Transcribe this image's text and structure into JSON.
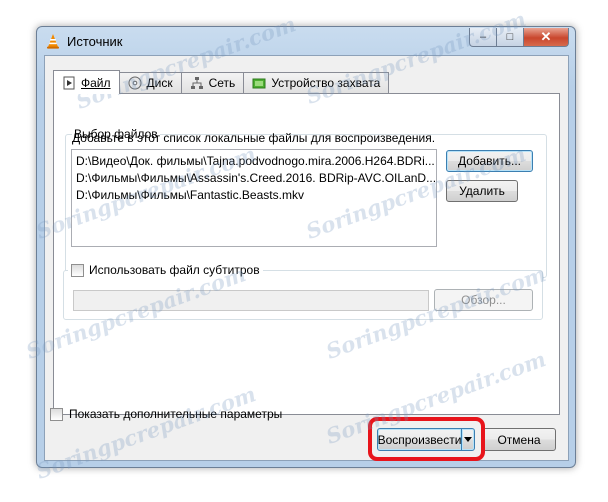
{
  "window": {
    "title": "Источник",
    "controls": {
      "minimize": "‒",
      "maximize": "□",
      "close": "✕"
    }
  },
  "tabs": [
    {
      "label": "Файл",
      "icon": "file-play-icon",
      "active": true
    },
    {
      "label": "Диск",
      "icon": "disc-icon",
      "active": false
    },
    {
      "label": "Сеть",
      "icon": "network-icon",
      "active": false
    },
    {
      "label": "Устройство захвата",
      "icon": "capture-device-icon",
      "active": false
    }
  ],
  "file_selection": {
    "legend": "Выбор файлов",
    "hint": "Добавьте в этот список локальные файлы для воспроизведения.",
    "files": [
      "D:\\Видео\\Док. фильмы\\Tajna.podvodnogo.mira.2006.H264.BDRi...",
      "D:\\Фильмы\\Фильмы\\Assassin's.Creed.2016. BDRip-AVC.OILanD...",
      "D:\\Фильмы\\Фильмы\\Fantastic.Beasts.mkv"
    ],
    "add_label": "Добавить...",
    "remove_label": "Удалить"
  },
  "subtitles": {
    "checkbox_label": "Использовать файл субтитров",
    "checked": false,
    "path_value": "",
    "browse_label": "Обзор..."
  },
  "show_more_options": {
    "label": "Показать дополнительные параметры",
    "checked": false
  },
  "actions": {
    "play_label": "Воспроизвести",
    "cancel_label": "Отмена"
  },
  "watermark_text": "Soringpcrepair.com",
  "colors": {
    "highlight": "#e8141b",
    "vlc_orange": "#f28a00"
  }
}
